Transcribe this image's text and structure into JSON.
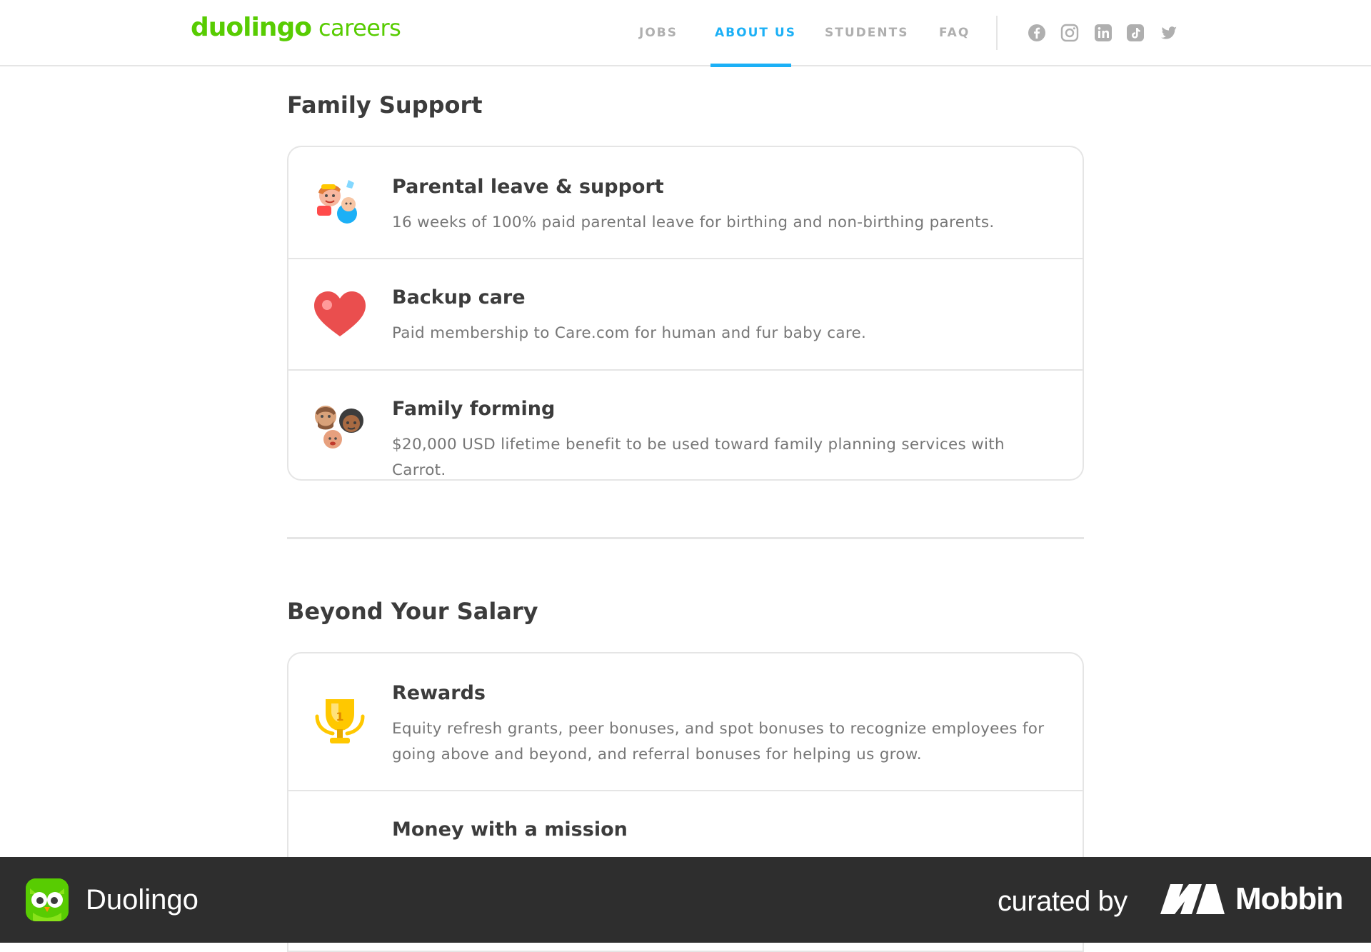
{
  "header": {
    "logo_word": "duolingo",
    "logo_sub": "careers",
    "nav": [
      {
        "label": "JOBS",
        "active": false
      },
      {
        "label": "ABOUT US",
        "active": true
      },
      {
        "label": "STUDENTS",
        "active": false
      },
      {
        "label": "FAQ",
        "active": false
      }
    ],
    "social_icons": [
      "facebook-icon",
      "instagram-icon",
      "linkedin-icon",
      "tiktok-icon",
      "twitter-icon"
    ],
    "accent_color": "#1cb0f6",
    "brand_color": "#58cc02"
  },
  "sections": [
    {
      "title": "Family Support",
      "items": [
        {
          "icon": "family-with-baby-icon",
          "title": "Parental leave & support",
          "description": "16 weeks of 100% paid parental leave for birthing and non-birthing parents."
        },
        {
          "icon": "heart-icon",
          "title": "Backup care",
          "description": "Paid membership to Care.com for human and fur baby care."
        },
        {
          "icon": "family-faces-icon",
          "title": "Family forming",
          "description": "$20,000 USD lifetime benefit to be used toward family planning services with Carrot."
        }
      ]
    },
    {
      "title": "Beyond Your Salary",
      "items": [
        {
          "icon": "trophy-icon",
          "title": "Rewards",
          "description": "Equity refresh grants, peer bonuses, and spot bonuses to recognize employees for going above and beyond, and referral bonuses for helping us grow."
        },
        {
          "icon": "bicycle-icon",
          "title": "Money with a mission",
          "description": ""
        }
      ]
    }
  ],
  "footer": {
    "app_name": "Duolingo",
    "curated_by": "curated by",
    "brand": "Mobbin"
  }
}
